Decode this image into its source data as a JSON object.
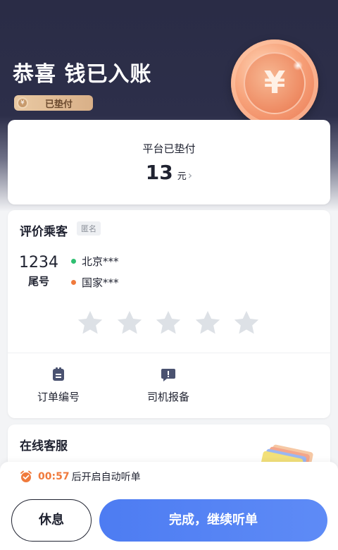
{
  "hero": {
    "title": "恭喜 钱已入账",
    "paid_tag": "已垫付",
    "coin_symbol": "¥"
  },
  "payment": {
    "label": "平台已垫付",
    "amount": "13",
    "unit": "元",
    "chevron": "›"
  },
  "rating": {
    "title": "评价乘客",
    "anonymous_badge": "匿名",
    "tail_number": "1234",
    "tail_label": "尾号",
    "route": {
      "from": "北京***",
      "to": "国家***"
    },
    "stars_total": 5,
    "stars_selected": 0
  },
  "actions": [
    {
      "label": "订单编号",
      "icon": "order-document-icon"
    },
    {
      "label": "司机报备",
      "icon": "report-chat-icon"
    }
  ],
  "customer_service": {
    "title": "在线客服"
  },
  "bottom": {
    "countdown": "00:57",
    "countdown_text": "后开启自动听单",
    "rest_button": "休息",
    "continue_button": "完成，继续听单"
  },
  "colors": {
    "header_bg": "#2a2c46",
    "accent_blue": "#4d7cf2",
    "accent_orange": "#f07a3c",
    "dot_green": "#2fbf71",
    "star_inactive": "#dde1e6"
  }
}
